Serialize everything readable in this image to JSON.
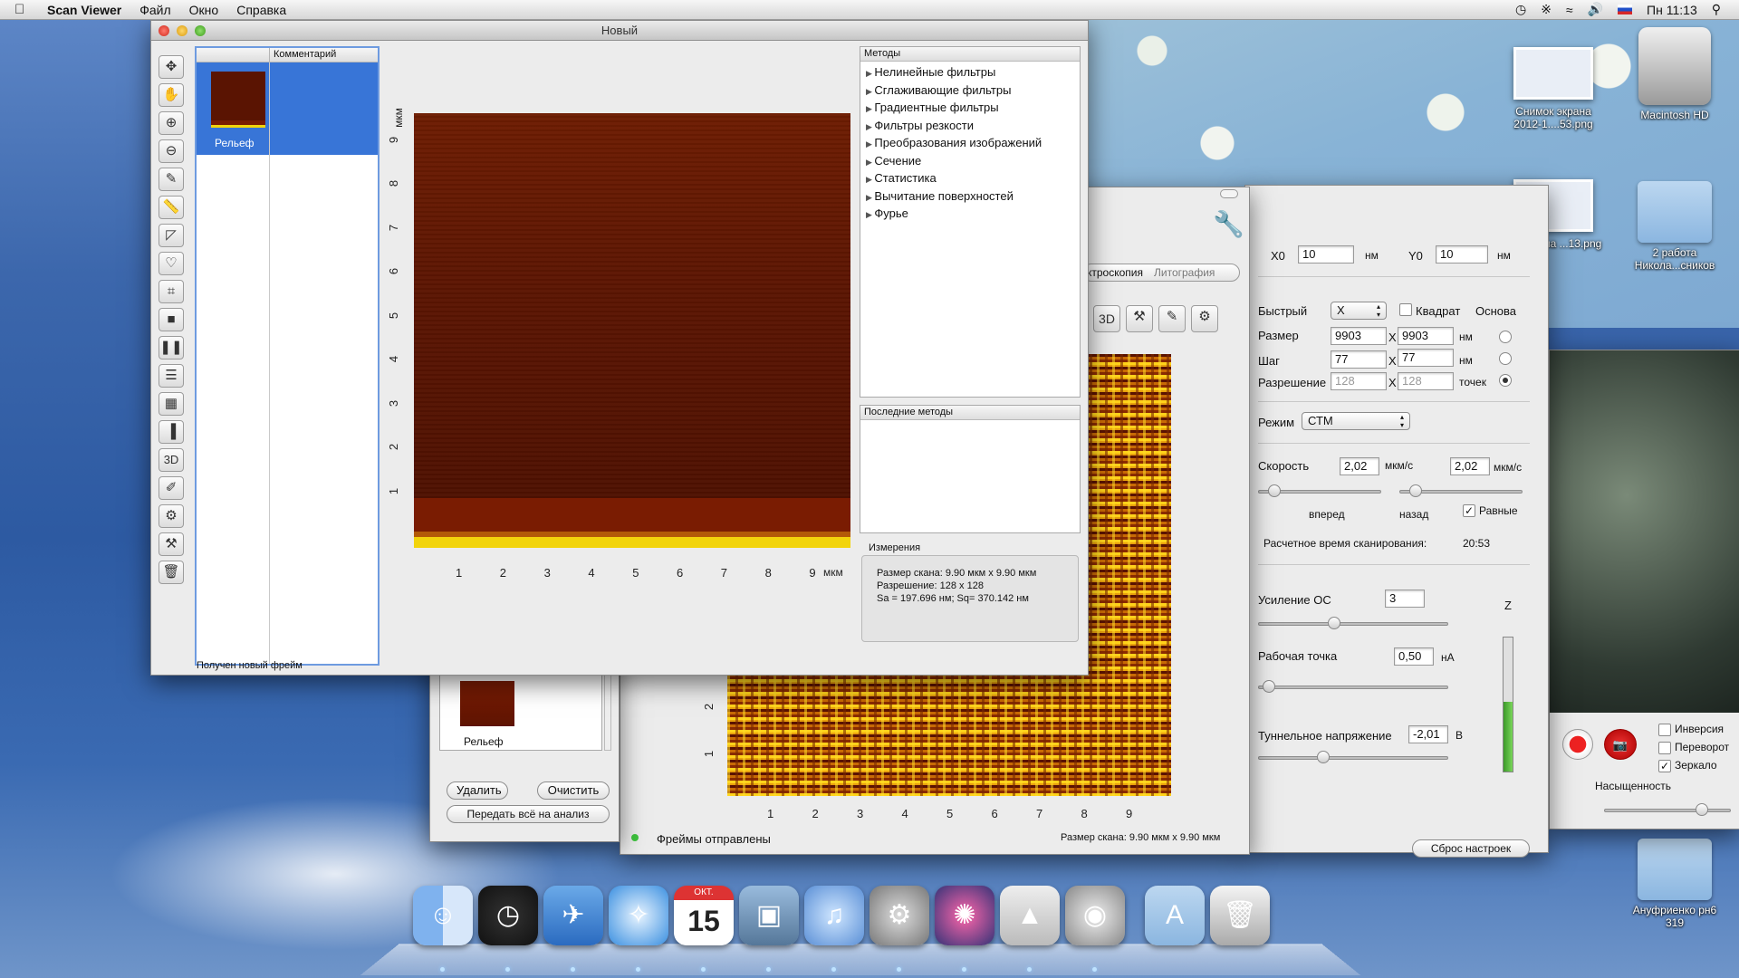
{
  "menubar": {
    "app_name": "Scan Viewer",
    "items": [
      "Файл",
      "Окно",
      "Справка"
    ],
    "flag": "RU",
    "clock": "Пн 11:13"
  },
  "desktop": {
    "icons": [
      {
        "label": "Снимок экрана 2012-1....53.png"
      },
      {
        "label": "Macintosh HD"
      },
      {
        "label": "...к экрана ...13.png"
      },
      {
        "label": "2 работа Никола...сников"
      },
      {
        "label": "Ануфриенко рн6 319"
      }
    ]
  },
  "main_window": {
    "title": "Новый",
    "frames_header": [
      "",
      "Комментарий"
    ],
    "frames": [
      {
        "name": "Рельеф",
        "comment": ""
      }
    ],
    "status": "Получен новый фрейм",
    "tools": [
      "move-icon",
      "hand-icon",
      "zoom-in-icon",
      "zoom-out-icon",
      "pipette-icon",
      "ruler-icon",
      "angle-icon",
      "mask-icon",
      "crop-icon",
      "stop-icon",
      "pause-icon",
      "rows-icon",
      "grid-icon",
      "palette-icon",
      "3D",
      "paint-icon",
      "gear-icon",
      "wrench-icon",
      "trash-icon"
    ],
    "tool_3d_label": "3D",
    "plot": {
      "y_unit": "мкм",
      "x_unit": "мкм",
      "y_ticks": [
        "1",
        "2",
        "3",
        "4",
        "5",
        "6",
        "7",
        "8",
        "9"
      ],
      "x_ticks": [
        "1",
        "2",
        "3",
        "4",
        "5",
        "6",
        "7",
        "8",
        "9"
      ]
    },
    "methods_header": "Методы",
    "methods": [
      "Нелинейные фильтры",
      "Сглаживающие фильтры",
      "Градиентные фильтры",
      "Фильтры резкости",
      "Преобразования изображений",
      "Сечение",
      "Статистика",
      "Вычитание поверхностей",
      "Фурье"
    ],
    "recent_header": "Последние методы",
    "measurements_header": "Измерения",
    "measurements": [
      "Размер скана: 9.90 мкм x 9.90 мкм",
      "Разрешение: 128 x 128",
      "Sa = 197.696 нм; Sq= 370.142 нм"
    ]
  },
  "frames_window": {
    "frame_name": "Рельеф",
    "delete": "Удалить",
    "clear": "Очистить",
    "send_all": "Передать всё на анализ"
  },
  "scan_window": {
    "tabs": [
      "ктроскопия",
      "Литография"
    ],
    "btn_3d": "3D",
    "y_ticks": [
      "1",
      "2"
    ],
    "x_ticks": [
      "1",
      "2",
      "3",
      "4",
      "5",
      "6",
      "7",
      "8",
      "9"
    ],
    "status": "Фреймы отправлены",
    "status_right": "Размер скана: 9.90 мкм x 9.90 мкм"
  },
  "settings_window": {
    "x0_label": "X0",
    "x0": "10",
    "x0_unit": "нм",
    "y0_label": "Y0",
    "y0": "10",
    "y0_unit": "нм",
    "fast_label": "Быстрый",
    "fast_value": "X",
    "square_label": "Квадрат",
    "basis_label": "Основа",
    "size_label": "Размер",
    "size_x": "9903",
    "size_y": "9903",
    "size_unit": "нм",
    "step_label": "Шаг",
    "step_x": "77",
    "step_y": "77",
    "step_unit": "нм",
    "res_label": "Разрешение",
    "res_x": "128",
    "res_y": "128",
    "res_unit": "точек",
    "x_sep": "X",
    "mode_label": "Режим",
    "mode_value": "СТМ",
    "speed_label": "Скорость",
    "speed_fwd": "2,02",
    "speed_unit": "мкм/с",
    "speed_back": "2,02",
    "speed_unit2": "мкм/с",
    "fwd_label": "вперед",
    "back_label": "назад",
    "equal_label": "Равные",
    "time_label": "Расчетное время сканирования:",
    "time_value": "20:53",
    "gain_label": "Усиление ОС",
    "gain_value": "3",
    "point_label": "Рабочая точка",
    "point_value": "0,50",
    "point_unit": "нА",
    "voltage_label": "Туннельное напряжение",
    "voltage_value": "-2,01",
    "voltage_unit": "В",
    "z_label": "Z",
    "z_level": 0.52,
    "reset_label": "Сброс настроек"
  },
  "camera_window": {
    "inversion": "Инверсия",
    "flip": "Переворот",
    "mirror": "Зеркало",
    "saturation": "Насыщенность"
  },
  "dock": {
    "items": [
      "finder-icon",
      "dashboard-icon",
      "mail-icon",
      "safari-icon",
      "calendar-icon",
      "photo-icon",
      "itunes-icon",
      "preferences-icon",
      "scan-app-icon",
      "pyramid-app-icon",
      "webcam-icon",
      "applications-folder-icon",
      "trash-icon"
    ],
    "calendar_month": "ОКТ.",
    "calendar_day": "15"
  }
}
